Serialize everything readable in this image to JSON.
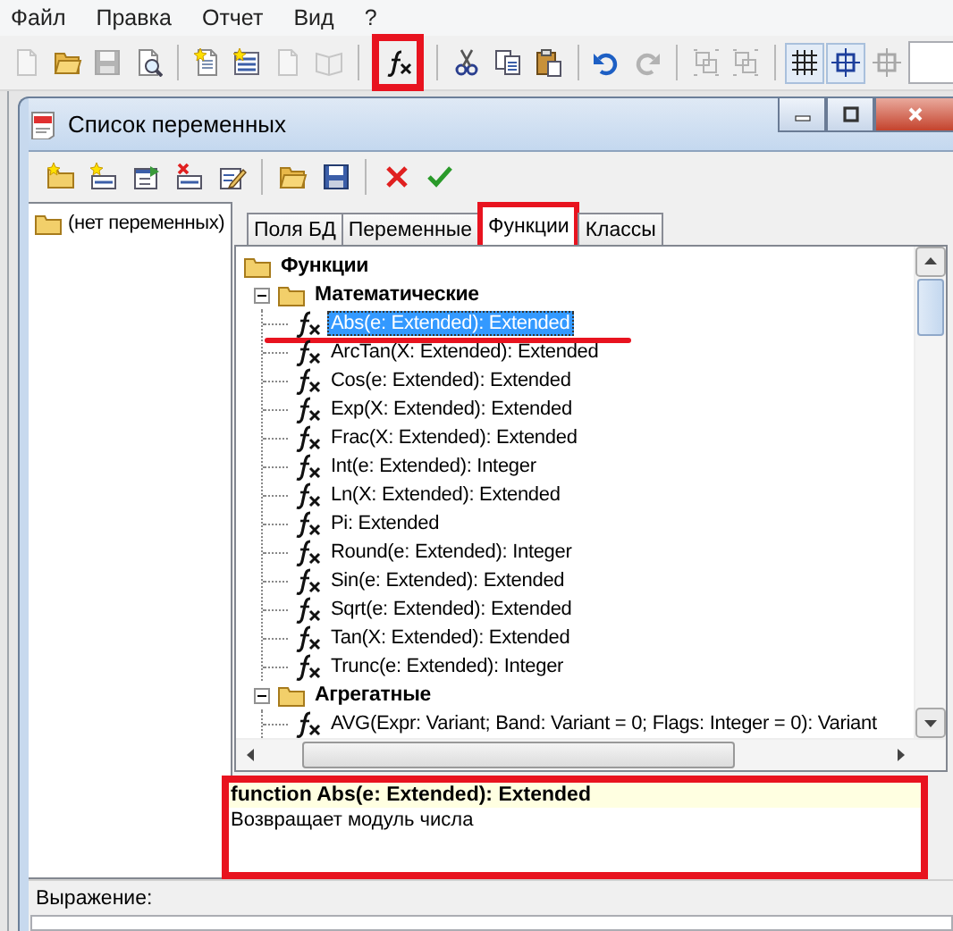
{
  "menu": [
    "Файл",
    "Правка",
    "Отчет",
    "Вид",
    "?"
  ],
  "toolbar": [
    [
      {
        "kind": "page",
        "disabled": true,
        "pressed": false,
        "marked": false
      },
      {
        "kind": "folder-open",
        "disabled": false,
        "pressed": false,
        "marked": false
      },
      {
        "kind": "disk",
        "disabled": true,
        "pressed": false,
        "marked": false
      },
      {
        "kind": "preview",
        "disabled": false,
        "pressed": false,
        "marked": false
      }
    ],
    [
      {
        "kind": "page-star",
        "disabled": false,
        "pressed": false,
        "marked": false
      },
      {
        "kind": "page-list",
        "disabled": false,
        "pressed": false,
        "marked": false
      },
      {
        "kind": "page",
        "disabled": true,
        "pressed": false,
        "marked": false
      },
      {
        "kind": "book",
        "disabled": true,
        "pressed": false,
        "marked": false
      }
    ],
    [
      {
        "kind": "function",
        "disabled": false,
        "pressed": false,
        "marked": true
      }
    ],
    [
      {
        "kind": "scissors",
        "disabled": false,
        "pressed": false,
        "marked": false
      },
      {
        "kind": "copy",
        "disabled": false,
        "pressed": false,
        "marked": false
      },
      {
        "kind": "paste",
        "disabled": false,
        "pressed": false,
        "marked": false
      }
    ],
    [
      {
        "kind": "undo",
        "disabled": false,
        "pressed": false,
        "marked": false
      },
      {
        "kind": "redo",
        "disabled": true,
        "pressed": false,
        "marked": false
      }
    ],
    [
      {
        "kind": "group",
        "disabled": true,
        "pressed": false,
        "marked": false
      },
      {
        "kind": "group",
        "disabled": true,
        "pressed": false,
        "marked": false
      }
    ],
    [
      {
        "kind": "grid",
        "disabled": false,
        "pressed": true,
        "marked": false
      },
      {
        "kind": "align",
        "disabled": false,
        "pressed": true,
        "marked": false
      },
      {
        "kind": "align",
        "disabled": true,
        "pressed": false,
        "marked": false
      }
    ]
  ],
  "dialog": {
    "title": "Список переменных",
    "toolbar": [
      [
        {
          "kind": "folder-star"
        },
        {
          "kind": "field-star"
        },
        {
          "kind": "props"
        },
        {
          "kind": "field-delete"
        },
        {
          "kind": "edit"
        }
      ],
      [
        {
          "kind": "folder-open"
        },
        {
          "kind": "disk"
        }
      ],
      [
        {
          "kind": "cross"
        },
        {
          "kind": "check"
        }
      ]
    ],
    "variables": [
      "(нет переменных)"
    ],
    "tabs": [
      {
        "label": "Поля БД",
        "selected": false,
        "marked": false
      },
      {
        "label": "Переменные",
        "selected": false,
        "marked": false
      },
      {
        "label": "Функции",
        "selected": true,
        "marked": true
      },
      {
        "label": "Классы",
        "selected": false,
        "marked": false
      }
    ],
    "tree": {
      "label": "Функции",
      "kind": "folder",
      "children": [
        {
          "label": "Математические",
          "kind": "folder",
          "expanded": true,
          "children": [
            {
              "label": "Abs(e: Extended): Extended",
              "kind": "function",
              "selected": true,
              "marked": true
            },
            {
              "label": "ArcTan(X: Extended): Extended",
              "kind": "function",
              "selected": false,
              "marked": false
            },
            {
              "label": "Cos(e: Extended): Extended",
              "kind": "function",
              "selected": false,
              "marked": false
            },
            {
              "label": "Exp(X: Extended): Extended",
              "kind": "function",
              "selected": false,
              "marked": false
            },
            {
              "label": "Frac(X: Extended): Extended",
              "kind": "function",
              "selected": false,
              "marked": false
            },
            {
              "label": "Int(e: Extended): Integer",
              "kind": "function",
              "selected": false,
              "marked": false
            },
            {
              "label": "Ln(X: Extended): Extended",
              "kind": "function",
              "selected": false,
              "marked": false
            },
            {
              "label": "Pi: Extended",
              "kind": "function",
              "selected": false,
              "marked": false
            },
            {
              "label": "Round(e: Extended): Integer",
              "kind": "function",
              "selected": false,
              "marked": false
            },
            {
              "label": "Sin(e: Extended): Extended",
              "kind": "function",
              "selected": false,
              "marked": false
            },
            {
              "label": "Sqrt(e: Extended): Extended",
              "kind": "function",
              "selected": false,
              "marked": false
            },
            {
              "label": "Tan(X: Extended): Extended",
              "kind": "function",
              "selected": false,
              "marked": false
            },
            {
              "label": "Trunc(e: Extended): Integer",
              "kind": "function",
              "selected": false,
              "marked": false
            }
          ]
        },
        {
          "label": "Агрегатные",
          "kind": "folder",
          "expanded": true,
          "children": [
            {
              "label": "AVG(Expr: Variant; Band: Variant = 0; Flags: Integer = 0): Variant",
              "kind": "function",
              "selected": false,
              "marked": false
            }
          ]
        }
      ]
    },
    "description": {
      "signature": "function Abs(e: Extended): Extended",
      "text": "Возвращает модуль числа",
      "marked": true
    },
    "expression": {
      "label": "Выражение:"
    }
  }
}
